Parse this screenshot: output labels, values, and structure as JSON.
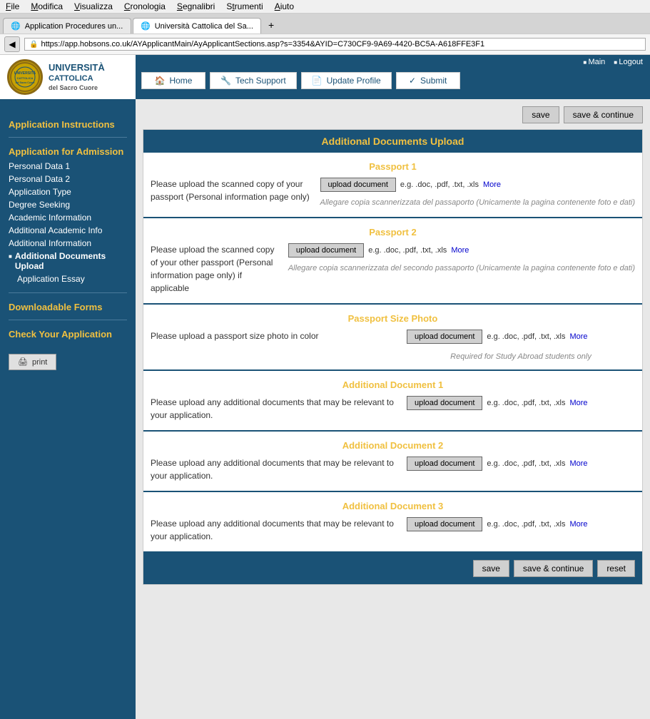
{
  "browser": {
    "menu": [
      "File",
      "Modifica",
      "Visualizza",
      "Cronologia",
      "Segnalibri",
      "Strumenti",
      "Aiuto"
    ],
    "tabs": [
      {
        "label": "Application Procedures un...",
        "active": false
      },
      {
        "label": "Università Cattolica del Sa...",
        "active": true
      }
    ],
    "address": "https://app.hobsons.co.uk/AYApplicantMain/AyApplicantSections.asp?s=3354&AYID=C730CF9-9A69-4420-BC5A-A618FFE3F1"
  },
  "header": {
    "links": [
      "Main",
      "Logout"
    ],
    "nav": [
      {
        "icon": "🏠",
        "label": "Home"
      },
      {
        "icon": "🔧",
        "label": "Tech Support"
      },
      {
        "icon": "📄",
        "label": "Update Profile"
      },
      {
        "icon": "✓",
        "label": "Submit"
      }
    ],
    "logo": {
      "university": "UNIVERSITÀ",
      "cattolica": "CATTOLICA",
      "sub": "del Sacro Cuore"
    }
  },
  "sidebar": {
    "sections": [
      {
        "title": "Application Instructions",
        "items": []
      },
      {
        "title": "Application for Admission",
        "items": [
          "Personal Data 1",
          "Personal Data 2",
          "Application Type",
          "Degree Seeking",
          "Academic Information",
          "Additional Academic Info",
          "Additional Information",
          "Additional Documents Upload",
          "Application Essay"
        ]
      },
      {
        "title": "Downloadable Forms",
        "items": []
      },
      {
        "title": "Check Your Application",
        "items": []
      }
    ],
    "print": "print"
  },
  "content": {
    "panel_title": "Additional Documents Upload",
    "save_label": "save",
    "save_continue_label": "save & continue",
    "reset_label": "reset",
    "sections": [
      {
        "id": "passport1",
        "title": "Passport 1",
        "desc": "Please upload the scanned copy of your passport (Personal information page only)",
        "upload_btn": "upload document",
        "hint": "e.g. .doc, .pdf, .txt, .xls",
        "more": "More",
        "italian": "Allegare copia scannerizzata del passaporto (Unicamente la pagina contenente foto e dati)"
      },
      {
        "id": "passport2",
        "title": "Passport 2",
        "desc": "Please upload the scanned copy of your other passport (Personal information page only) if applicable",
        "upload_btn": "upload document",
        "hint": "e.g. .doc, .pdf, .txt, .xls",
        "more": "More",
        "italian": "Allegare copia scannerizzata del secondo passaporto (Unicamente la pagina contenente foto e dati)"
      },
      {
        "id": "passport-photo",
        "title": "Passport Size Photo",
        "desc": "Please upload a passport size photo in color",
        "upload_btn": "upload document",
        "hint": "e.g. .doc, .pdf, .txt, .xls",
        "more": "More",
        "italian": "Required for Study Abroad students only"
      },
      {
        "id": "additional1",
        "title": "Additional Document 1",
        "desc": "Please upload any additional documents that may be relevant to your application.",
        "upload_btn": "upload document",
        "hint": "e.g. .doc, .pdf, .txt, .xls",
        "more": "More",
        "italian": ""
      },
      {
        "id": "additional2",
        "title": "Additional Document 2",
        "desc": "Please upload any additional documents that may be relevant to your application.",
        "upload_btn": "upload document",
        "hint": "e.g. .doc, .pdf, .txt, .xls",
        "more": "More",
        "italian": ""
      },
      {
        "id": "additional3",
        "title": "Additional Document 3",
        "desc": "Please upload any additional documents that may be relevant to your application.",
        "upload_btn": "upload document",
        "hint": "e.g. .doc, .pdf, .txt, .xls",
        "more": "More",
        "italian": ""
      }
    ]
  }
}
